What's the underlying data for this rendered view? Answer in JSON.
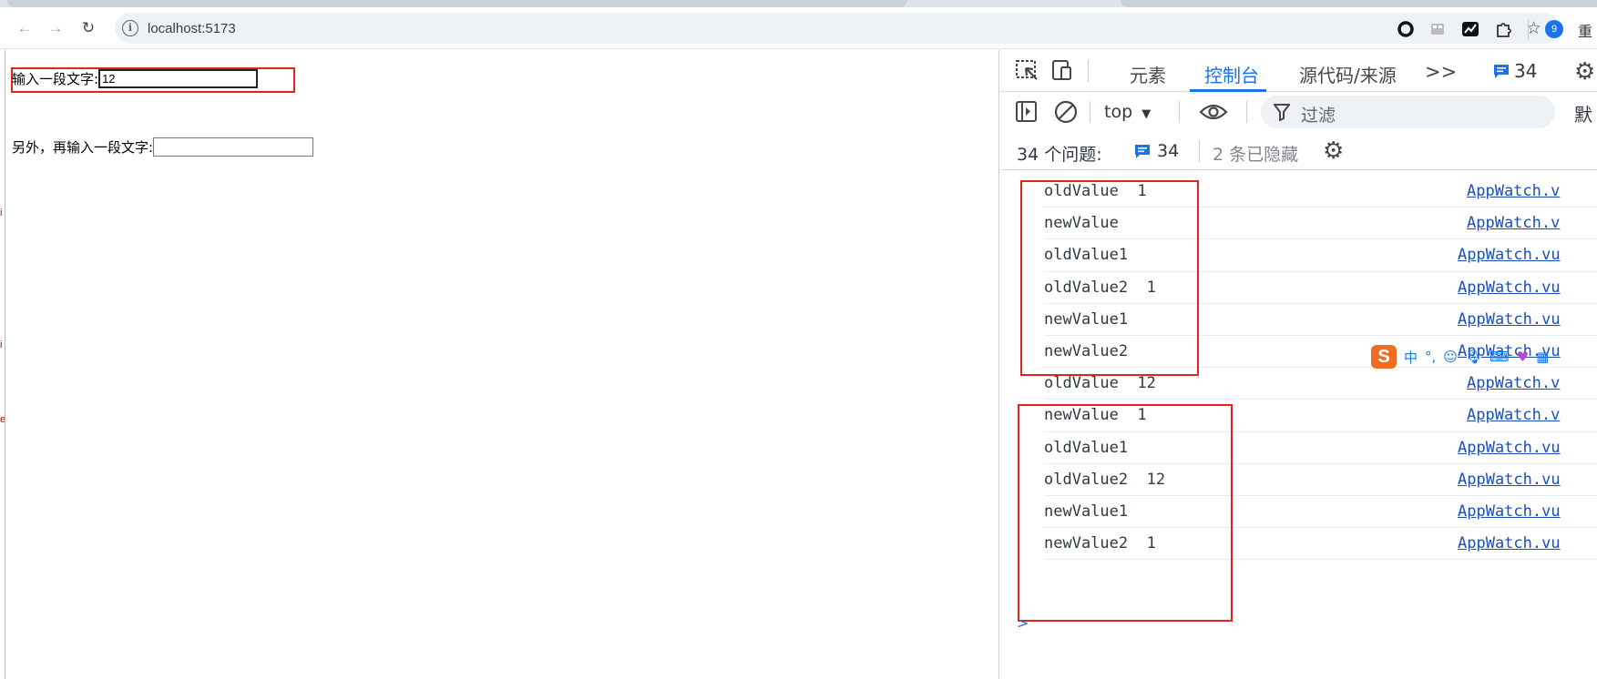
{
  "browser": {
    "url": "localhost:5173",
    "nav": {
      "back": "←",
      "forward": "→",
      "reload": "↻"
    },
    "profile_badge": "9",
    "edge_label": "重"
  },
  "page": {
    "field1": {
      "label": "输入一段文字:",
      "value": "12"
    },
    "field2": {
      "label": "另外，再输入一段文字:",
      "value": ""
    }
  },
  "devtools": {
    "tabs": {
      "elements": "元素",
      "console": "控制台",
      "sources": "源代码/来源",
      "more": ">>"
    },
    "issues_badge": "34",
    "context": "top",
    "filter_placeholder": "过滤",
    "default_levels": "默",
    "issues": {
      "label": "34 个问题:",
      "count": "34",
      "hidden": "2 条已隐藏"
    },
    "logs": [
      {
        "msg": "oldValue  1",
        "src": "AppWatch.v"
      },
      {
        "msg": "newValue",
        "src": "AppWatch.v"
      },
      {
        "msg": "oldValue1",
        "src": "AppWatch.vu"
      },
      {
        "msg": "oldValue2  1",
        "src": "AppWatch.vu"
      },
      {
        "msg": "newValue1",
        "src": "AppWatch.vu"
      },
      {
        "msg": "newValue2",
        "src": "AppWatch.vu"
      },
      {
        "msg": "oldValue  12",
        "src": "AppWatch.v"
      },
      {
        "msg": "newValue  1",
        "src": "AppWatch.v"
      },
      {
        "msg": "oldValue1",
        "src": "AppWatch.vu"
      },
      {
        "msg": "oldValue2  12",
        "src": "AppWatch.vu"
      },
      {
        "msg": "newValue1",
        "src": "AppWatch.vu"
      },
      {
        "msg": "newValue2  1",
        "src": "AppWatch.vu"
      }
    ],
    "prompt": ">"
  },
  "ime": {
    "logo": "S",
    "lang": "中"
  },
  "colors": {
    "accent": "#1a73e8",
    "highlight": "#e4231b",
    "link": "#1a50b8"
  }
}
